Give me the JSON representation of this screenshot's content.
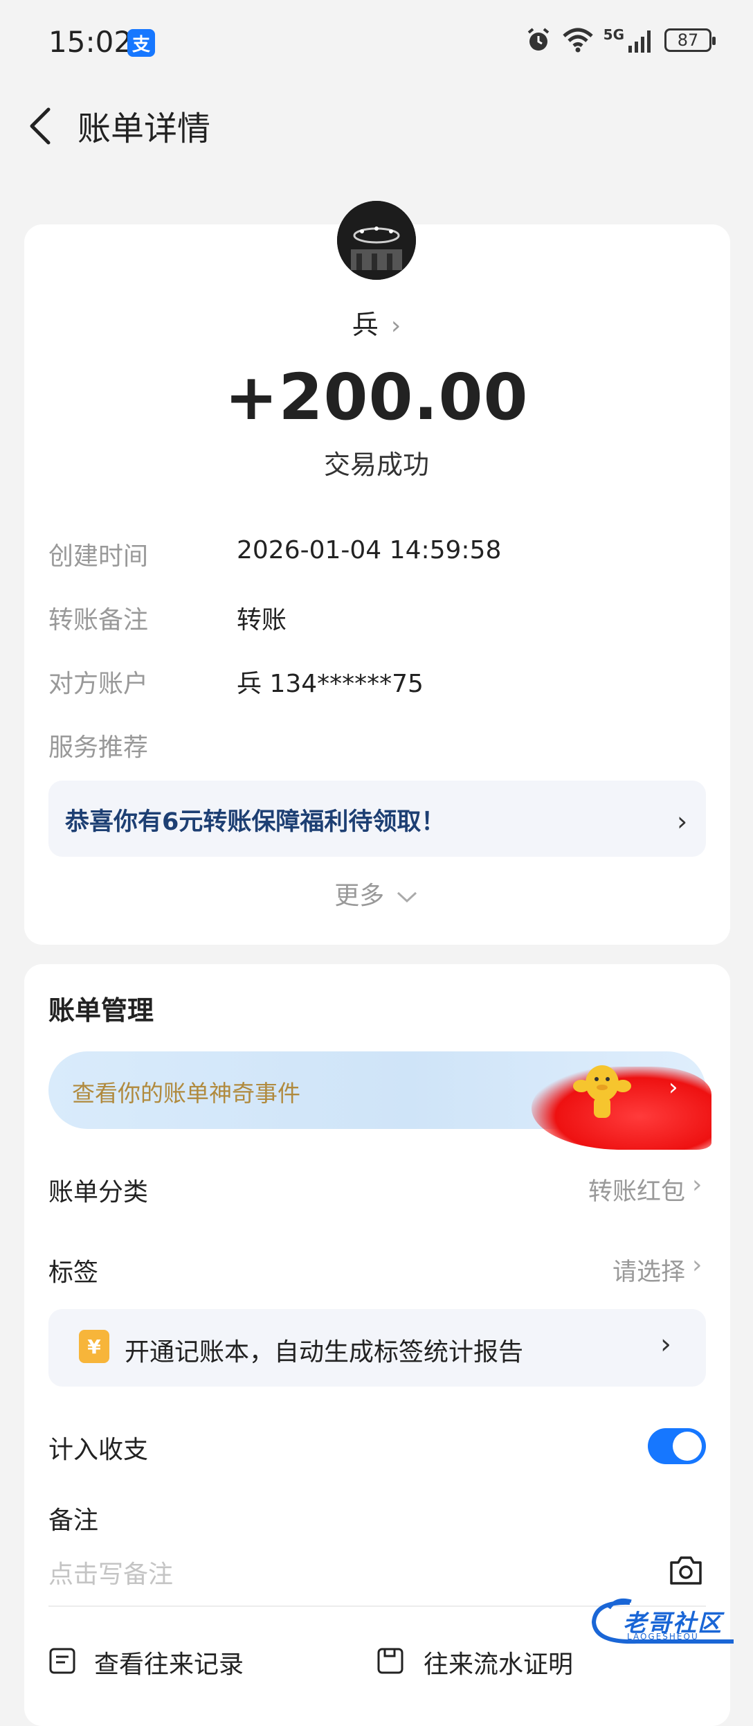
{
  "status_bar": {
    "time": "15:02",
    "app_badge": "支",
    "network": "5G",
    "battery": "87"
  },
  "header": {
    "title": "账单详情"
  },
  "transaction": {
    "payee": "兵",
    "amount": "+200.00",
    "status": "交易成功",
    "details": [
      {
        "label": "创建时间",
        "value": "2026-01-04 14:59:58"
      },
      {
        "label": "转账备注",
        "value": "转账"
      },
      {
        "label": "对方账户",
        "value": "兵 134******75"
      },
      {
        "label": "服务推荐",
        "value": ""
      }
    ],
    "promo": "恭喜你有6元转账保障福利待领取！",
    "more": "更多"
  },
  "bill_management": {
    "title": "账单管理",
    "banner": "查看你的账单神奇事件",
    "category": {
      "label": "账单分类",
      "value": "转账红包"
    },
    "tag": {
      "label": "标签",
      "value": "请选择"
    },
    "ledger_promo": {
      "icon": "¥",
      "text": "开通记账本，自动生成标签统计报告"
    },
    "count_in": {
      "label": "计入收支",
      "enabled": true
    },
    "note": {
      "label": "备注",
      "placeholder": "点击写备注"
    },
    "links": [
      "查看往来记录",
      "往来流水证明"
    ]
  },
  "watermark": {
    "text": "老哥社区",
    "sub": "LAOGESHEQU"
  },
  "colors": {
    "accent": "#1677ff",
    "promo_text": "#1d3f73",
    "banner_text": "#b08a3e"
  }
}
